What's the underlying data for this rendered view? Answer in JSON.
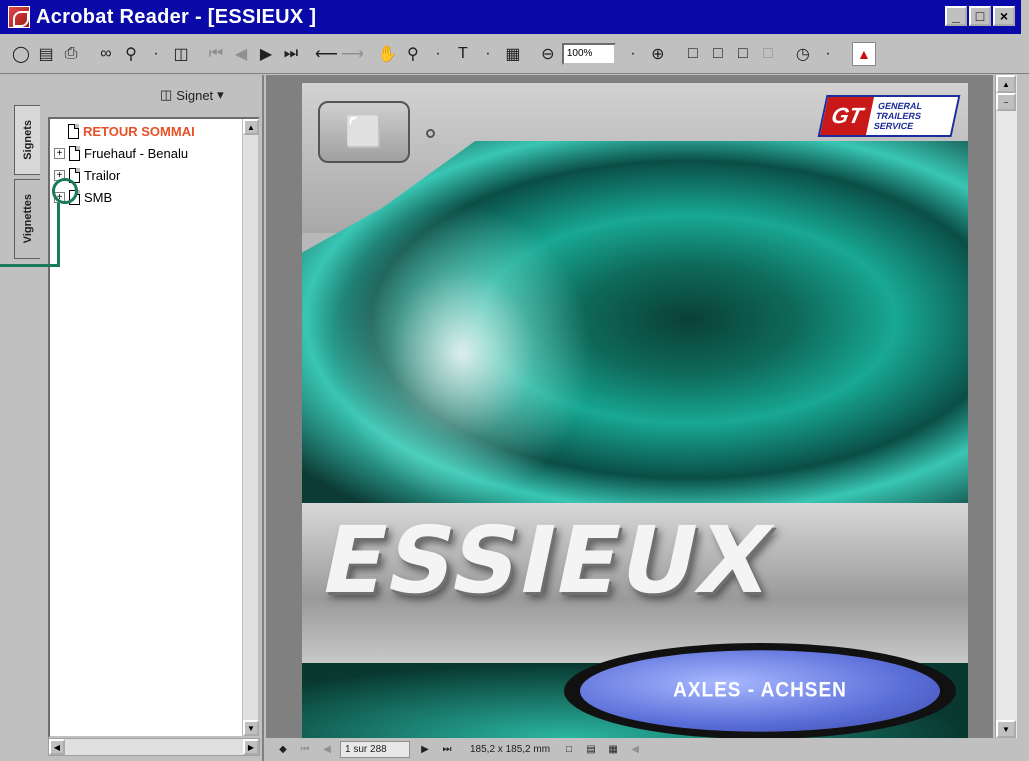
{
  "window": {
    "title": "Acrobat Reader - [ESSIEUX ]",
    "minimize": "_",
    "maximize": "□",
    "close": "×"
  },
  "toolbar": {
    "zoom_value": "100%",
    "icons": [
      "open-icon",
      "save-icon",
      "print-icon",
      "find-icon",
      "search-icon",
      "show-hide-navigation-icon",
      "first-page-icon",
      "previous-page-icon",
      "next-page-icon",
      "last-page-icon",
      "go-back-icon",
      "go-forward-icon",
      "hand-tool-icon",
      "zoom-tool-icon",
      "text-select-icon",
      "graphics-select-icon",
      "zoom-out-icon",
      "zoom-in-icon",
      "actual-size-icon",
      "fit-page-icon",
      "fit-width-icon",
      "reflow-icon",
      "comment-icon",
      "acrobat-logo-icon"
    ]
  },
  "left_panel": {
    "signet_menu": "Signet",
    "tabs": [
      {
        "label": "Signets",
        "active": true
      },
      {
        "label": "Vignettes",
        "active": false
      }
    ],
    "bookmarks": [
      {
        "label": "RETOUR SOMMAI",
        "expander": "",
        "red": true
      },
      {
        "label": "Fruehauf - Benalu",
        "expander": "+",
        "red": false
      },
      {
        "label": "Trailor",
        "expander": "+",
        "red": false
      },
      {
        "label": "SMB",
        "expander": "+",
        "red": false
      }
    ]
  },
  "document": {
    "cover_word": "ESSIEUX",
    "subtitle": "AXLES - ACHSEN",
    "logo_mark": "GT",
    "logo_text": [
      "GENERAL",
      "TRAILERS",
      "SERVICE"
    ]
  },
  "statusbar": {
    "page_field": "1 sur 288",
    "page_size": "185,2 x 185,2 mm"
  },
  "colors": {
    "titlebar": "#0a0aa8",
    "bookmark_red": "#e85028",
    "callout_green": "#1a7a5a",
    "teal": "#18a894"
  }
}
